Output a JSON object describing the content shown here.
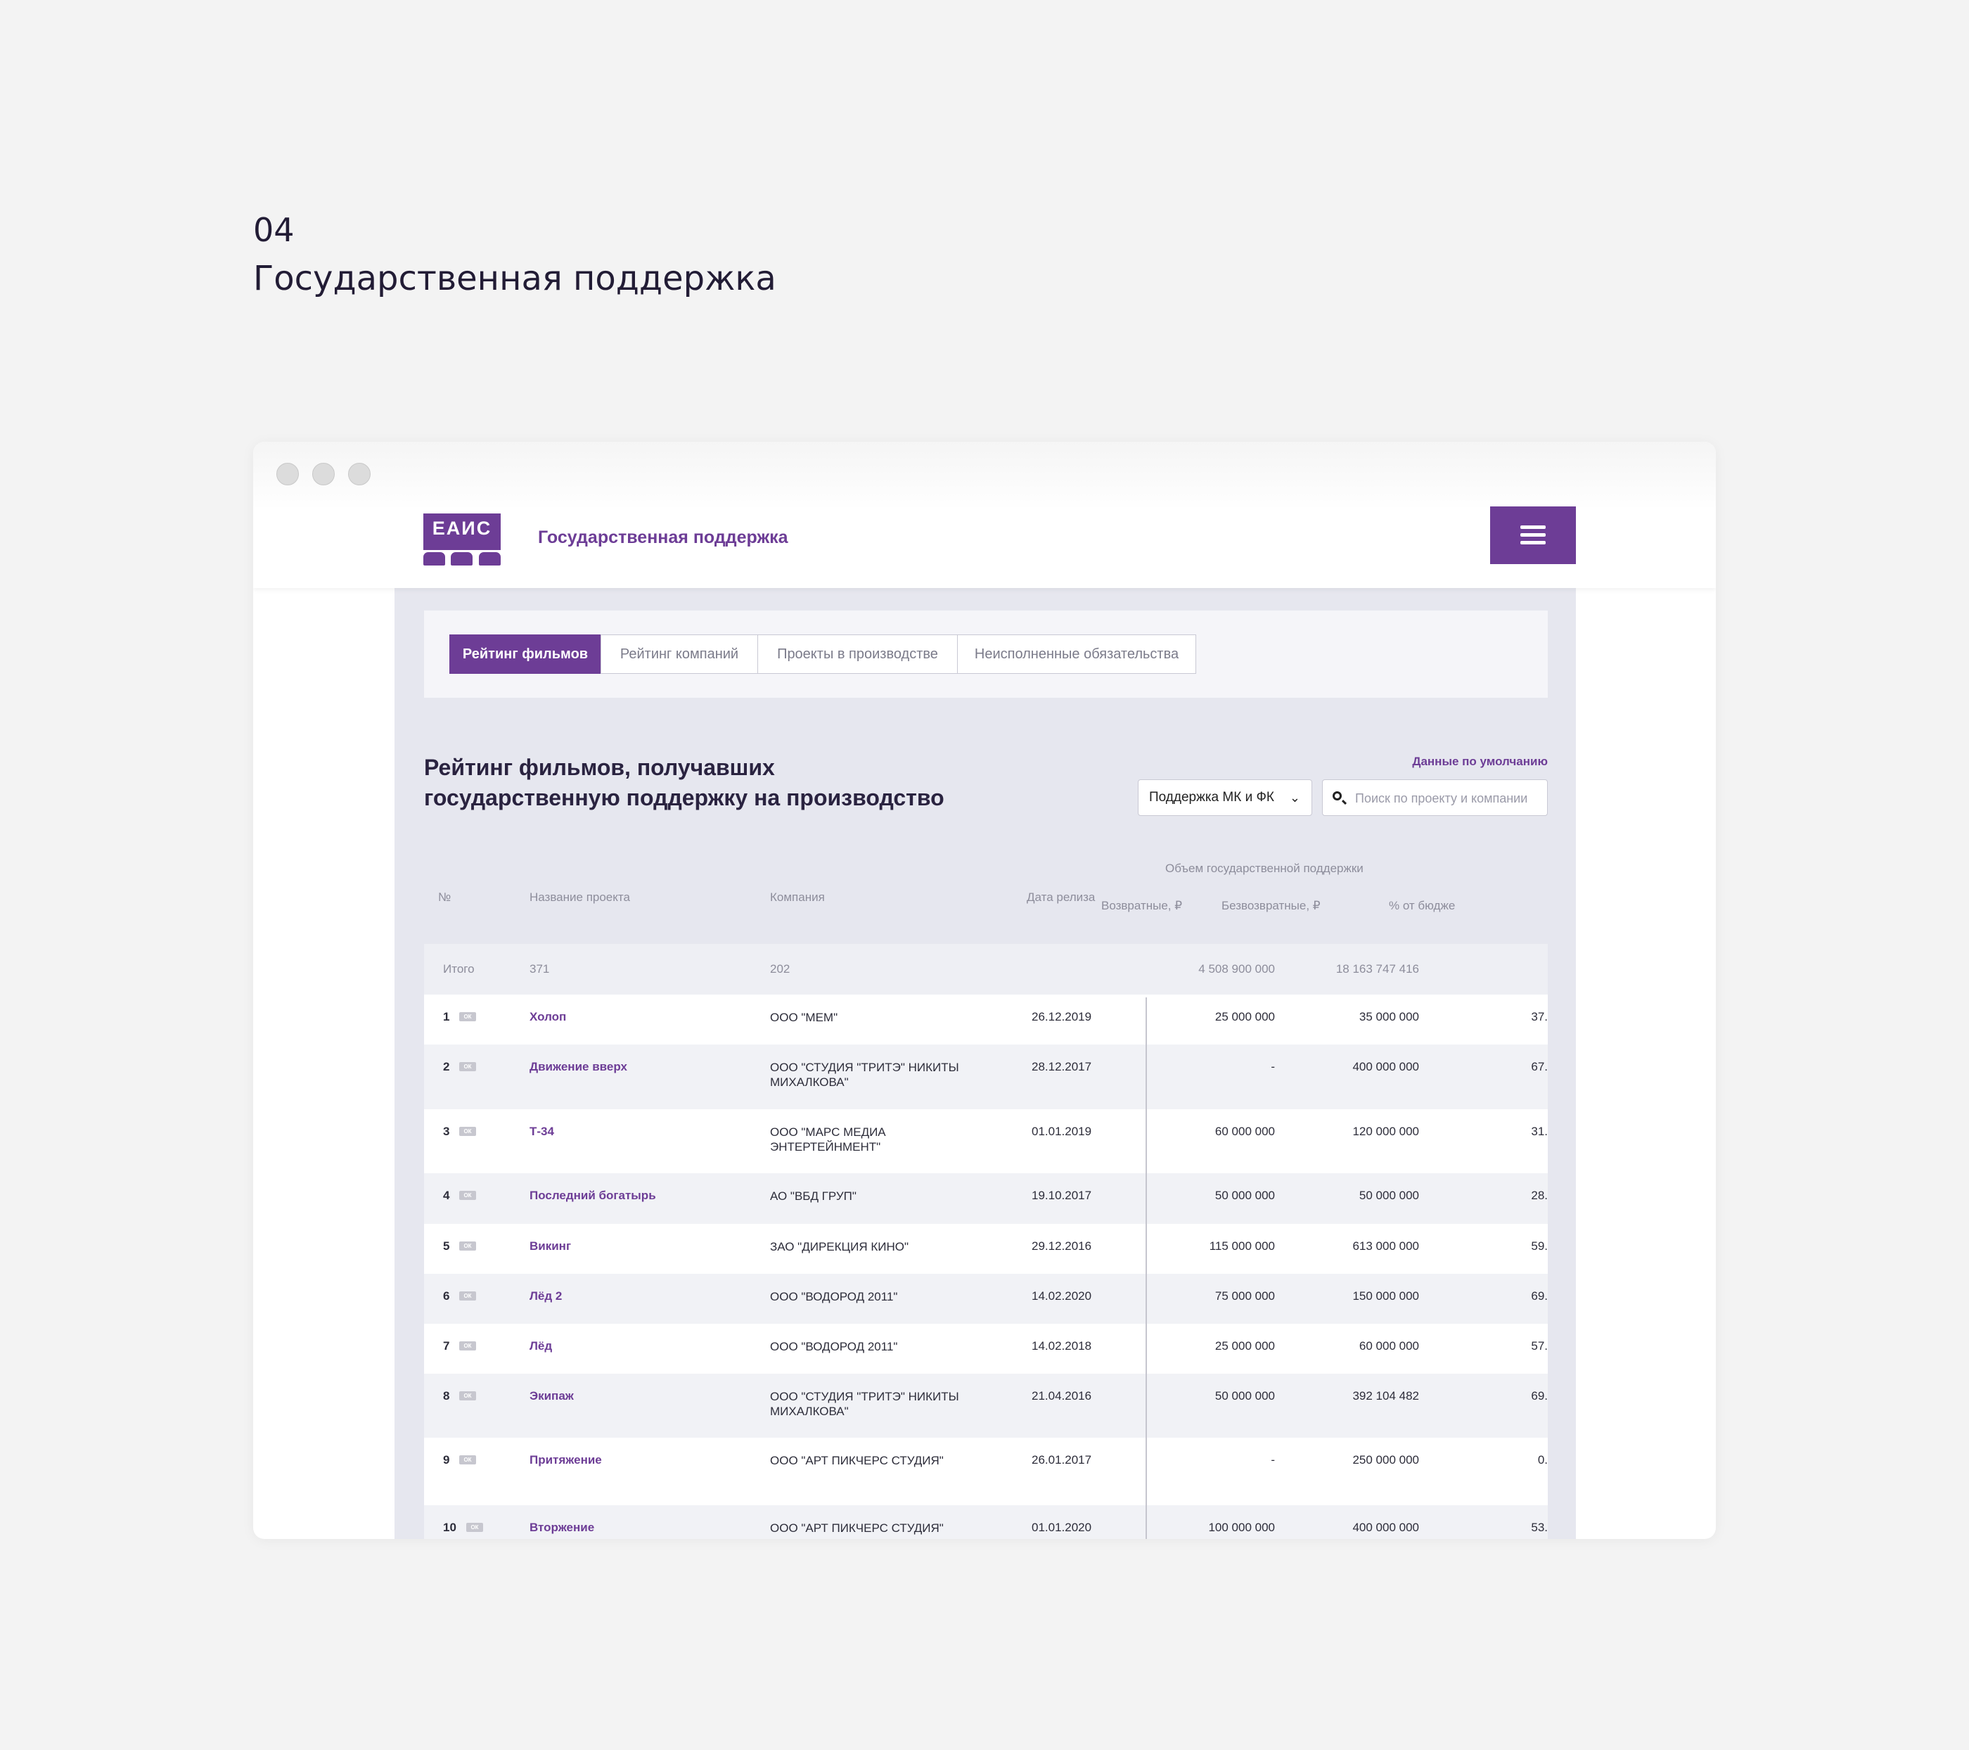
{
  "slide": {
    "number": "04",
    "title": "Государственная поддержка"
  },
  "site": {
    "logo_text": "ЕАИС",
    "title": "Государственная поддержка"
  },
  "tabs": [
    {
      "label": "Рейтинг фильмов",
      "active": true
    },
    {
      "label": "Рейтинг компаний",
      "active": false
    },
    {
      "label": "Проекты в производстве",
      "active": false
    },
    {
      "label": "Неисполненные обязательства",
      "active": false
    }
  ],
  "page": {
    "heading_line1": "Рейтинг фильмов, получавших",
    "heading_line2": "государственную поддержку на производство",
    "defaults_link": "Данные по умолчанию",
    "filter_selected": "Поддержка МК и ФК",
    "search_placeholder": "Поиск по проекту и компании"
  },
  "table": {
    "columns": {
      "num": "№",
      "project": "Название проекта",
      "company": "Компания",
      "release": "Дата релиза",
      "group": "Объем государственной поддержки",
      "returnable": "Возвратные, ₽",
      "nonreturnable": "Безвозвратные, ₽",
      "percent": "% от бюдже"
    },
    "total": {
      "label": "Итого",
      "projects": "371",
      "companies": "202",
      "returnable": "4 508 900 000",
      "nonreturnable": "18 163 747 416"
    },
    "rows": [
      {
        "rank": "1",
        "badge": "ОК",
        "title": "Холоп",
        "company": "ООО \"МЕМ\"",
        "date": "26.12.2019",
        "returnable": "25 000 000",
        "nonreturnable": "35 000 000",
        "percent": "37."
      },
      {
        "rank": "2",
        "badge": "ОК",
        "title": "Движение вверх",
        "company": "ООО \"СТУДИЯ \"ТРИТЭ\" НИКИТЫ МИХАЛКОВА\"",
        "date": "28.12.2017",
        "returnable": "-",
        "nonreturnable": "400 000 000",
        "percent": "67."
      },
      {
        "rank": "3",
        "badge": "ОК",
        "title": "Т-34",
        "company": "ООО \"МАРС МЕДИА ЭНТЕРТЕЙНМЕНТ\"",
        "date": "01.01.2019",
        "returnable": "60 000 000",
        "nonreturnable": "120 000 000",
        "percent": "31."
      },
      {
        "rank": "4",
        "badge": "ОК",
        "title": "Последний богатырь",
        "company": "АО \"ВБД ГРУП\"",
        "date": "19.10.2017",
        "returnable": "50 000 000",
        "nonreturnable": "50 000 000",
        "percent": "28."
      },
      {
        "rank": "5",
        "badge": "ОК",
        "title": "Викинг",
        "company": "ЗАО \"ДИРЕКЦИЯ КИНО\"",
        "date": "29.12.2016",
        "returnable": "115 000 000",
        "nonreturnable": "613 000 000",
        "percent": "59."
      },
      {
        "rank": "6",
        "badge": "ОК",
        "title": "Лёд 2",
        "company": "ООО \"ВОДОРОД 2011\"",
        "date": "14.02.2020",
        "returnable": "75 000 000",
        "nonreturnable": "150 000 000",
        "percent": "69."
      },
      {
        "rank": "7",
        "badge": "ОК",
        "title": "Лёд",
        "company": "ООО \"ВОДОРОД 2011\"",
        "date": "14.02.2018",
        "returnable": "25 000 000",
        "nonreturnable": "60 000 000",
        "percent": "57."
      },
      {
        "rank": "8",
        "badge": "ОК",
        "title": "Экипаж",
        "company": "ООО \"СТУДИЯ \"ТРИТЭ\" НИКИТЫ МИХАЛКОВА\"",
        "date": "21.04.2016",
        "returnable": "50 000 000",
        "nonreturnable": "392 104 482",
        "percent": "69."
      },
      {
        "rank": "9",
        "badge": "ОК",
        "title": "Притяжение",
        "company": "ООО \"АРТ ПИКЧЕРС СТУДИЯ\"",
        "date": "26.01.2017",
        "returnable": "-",
        "nonreturnable": "250 000 000",
        "percent": "0."
      },
      {
        "rank": "10",
        "badge": "ОК",
        "title": "Вторжение",
        "company": "ООО \"АРТ ПИКЧЕРС СТУДИЯ\"",
        "date": "01.01.2020",
        "returnable": "100 000 000",
        "nonreturnable": "400 000 000",
        "percent": "53."
      }
    ]
  },
  "colors": {
    "accent": "#6d3d96",
    "content_bg": "#e6e7ef",
    "page_bg": "#f3f3f3"
  }
}
